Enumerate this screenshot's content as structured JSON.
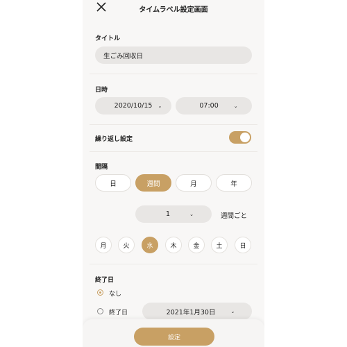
{
  "header": {
    "title": "タイムラベル設定画面",
    "close_icon": "close-icon"
  },
  "title_section": {
    "label": "タイトル",
    "value": "生ごみ回収日"
  },
  "datetime_section": {
    "label": "日時",
    "date": "2020/10/15",
    "time": "07:00"
  },
  "repeat_section": {
    "label": "繰り返し設定",
    "enabled": true
  },
  "interval_section": {
    "label": "間隔",
    "options": [
      "日",
      "週間",
      "月",
      "年"
    ],
    "selected": "週間",
    "count": "1",
    "suffix": "週間ごと"
  },
  "weekdays": {
    "days": [
      "月",
      "火",
      "水",
      "木",
      "金",
      "土",
      "日"
    ],
    "selected": "水"
  },
  "end_section": {
    "label": "終了日",
    "option_none": "なし",
    "option_end": "終了日",
    "selected": "なし",
    "end_date": "2021年1月30日"
  },
  "footer": {
    "submit_label": "設定"
  },
  "colors": {
    "accent": "#c8a064",
    "field": "#e8e6e4",
    "background": "#f8f7f6"
  }
}
